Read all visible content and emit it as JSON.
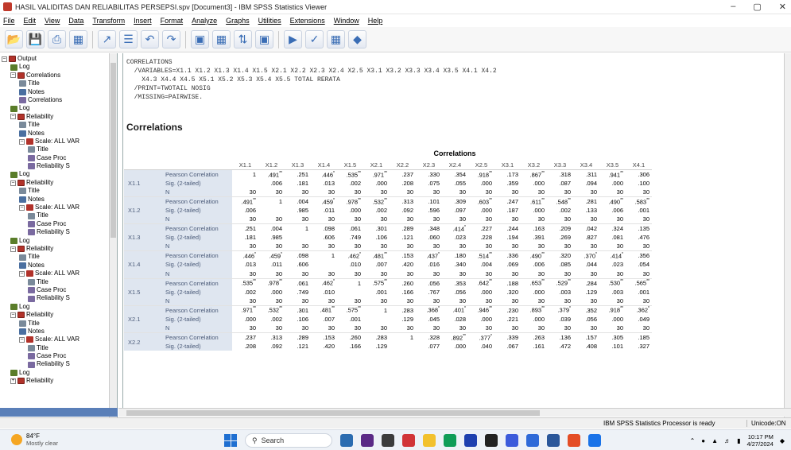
{
  "window": {
    "title": "HASIL VALIDITAS DAN RELIABILITAS PERSEPSI.spv [Document3] - IBM SPSS Statistics Viewer",
    "controls": [
      "–",
      "▢",
      "✕"
    ]
  },
  "menu": [
    "File",
    "Edit",
    "View",
    "Data",
    "Transform",
    "Insert",
    "Format",
    "Analyze",
    "Graphs",
    "Utilities",
    "Extensions",
    "Window",
    "Help"
  ],
  "toolbar": {
    "buttons": [
      "open-folder-icon",
      "save-icon",
      "print-icon",
      "print-preview-icon",
      "export-icon",
      "recall-dialog-icon",
      "undo-icon",
      "redo-icon",
      "goto-data-icon",
      "goto-case-icon",
      "variables-icon",
      "split-icon",
      "insert-output-icon",
      "select-cases-icon",
      "show-all-icon",
      "designated-window-icon"
    ]
  },
  "outline": {
    "items": [
      {
        "depth": 0,
        "label": "Output",
        "icon": "book",
        "exp": "–"
      },
      {
        "depth": 1,
        "label": "Log",
        "icon": "log"
      },
      {
        "depth": 1,
        "label": "Correlations",
        "icon": "book",
        "exp": "–"
      },
      {
        "depth": 2,
        "label": "Title",
        "icon": "title"
      },
      {
        "depth": 2,
        "label": "Notes",
        "icon": "notes"
      },
      {
        "depth": 2,
        "label": "Correlations",
        "icon": "table"
      },
      {
        "depth": 1,
        "label": "Log",
        "icon": "log"
      },
      {
        "depth": 1,
        "label": "Reliability",
        "icon": "book",
        "exp": "–"
      },
      {
        "depth": 2,
        "label": "Title",
        "icon": "title"
      },
      {
        "depth": 2,
        "label": "Notes",
        "icon": "notes"
      },
      {
        "depth": 2,
        "label": "Scale: ALL VAR",
        "icon": "scale",
        "exp": "–"
      },
      {
        "depth": 3,
        "label": "Title",
        "icon": "title"
      },
      {
        "depth": 3,
        "label": "Case Proc",
        "icon": "table"
      },
      {
        "depth": 3,
        "label": "Reliability S",
        "icon": "table"
      },
      {
        "depth": 1,
        "label": "Log",
        "icon": "log"
      },
      {
        "depth": 1,
        "label": "Reliability",
        "icon": "book",
        "exp": "–"
      },
      {
        "depth": 2,
        "label": "Title",
        "icon": "title"
      },
      {
        "depth": 2,
        "label": "Notes",
        "icon": "notes"
      },
      {
        "depth": 2,
        "label": "Scale: ALL VAR",
        "icon": "scale",
        "exp": "–"
      },
      {
        "depth": 3,
        "label": "Title",
        "icon": "title"
      },
      {
        "depth": 3,
        "label": "Case Proc",
        "icon": "table"
      },
      {
        "depth": 3,
        "label": "Reliability S",
        "icon": "table"
      },
      {
        "depth": 1,
        "label": "Log",
        "icon": "log"
      },
      {
        "depth": 1,
        "label": "Reliability",
        "icon": "book",
        "exp": "–"
      },
      {
        "depth": 2,
        "label": "Title",
        "icon": "title"
      },
      {
        "depth": 2,
        "label": "Notes",
        "icon": "notes"
      },
      {
        "depth": 2,
        "label": "Scale: ALL VAR",
        "icon": "scale",
        "exp": "–"
      },
      {
        "depth": 3,
        "label": "Title",
        "icon": "title"
      },
      {
        "depth": 3,
        "label": "Case Proc",
        "icon": "table"
      },
      {
        "depth": 3,
        "label": "Reliability S",
        "icon": "table"
      },
      {
        "depth": 1,
        "label": "Log",
        "icon": "log"
      },
      {
        "depth": 1,
        "label": "Reliability",
        "icon": "book",
        "exp": "–"
      },
      {
        "depth": 2,
        "label": "Title",
        "icon": "title"
      },
      {
        "depth": 2,
        "label": "Notes",
        "icon": "notes"
      },
      {
        "depth": 2,
        "label": "Scale: ALL VAR",
        "icon": "scale",
        "exp": "–"
      },
      {
        "depth": 3,
        "label": "Title",
        "icon": "title"
      },
      {
        "depth": 3,
        "label": "Case Proc",
        "icon": "table"
      },
      {
        "depth": 3,
        "label": "Reliability S",
        "icon": "table"
      },
      {
        "depth": 1,
        "label": "Log",
        "icon": "log"
      },
      {
        "depth": 1,
        "label": "Reliability",
        "icon": "book",
        "exp": "+"
      }
    ]
  },
  "syntax": "CORRELATIONS\n  /VARIABLES=X1.1 X1.2 X1.3 X1.4 X1.5 X2.1 X2.2 X2.3 X2.4 X2.5 X3.1 X3.2 X3.3 X3.4 X3.5 X4.1 X4.2\n    X4.3 X4.4 X4.5 X5.1 X5.2 X5.3 X5.4 X5.5 TOTAL RERATA\n  /PRINT=TWOTAIL NOSIG\n  /MISSING=PAIRWISE.",
  "heading": "Correlations",
  "table": {
    "title": "Correlations",
    "columns": [
      "X1.1",
      "X1.2",
      "X1.3",
      "X1.4",
      "X1.5",
      "X2.1",
      "X2.2",
      "X2.3",
      "X2.4",
      "X2.5",
      "X3.1",
      "X3.2",
      "X3.3",
      "X3.4",
      "X3.5",
      "X4.1"
    ],
    "stats": [
      "Pearson Correlation",
      "Sig. (2-tailed)",
      "N"
    ],
    "rows": [
      {
        "var": "X1.1",
        "values": [
          [
            "1",
            ".491**",
            ".251",
            ".446*",
            ".535**",
            ".971**",
            ".237",
            ".330",
            ".354",
            ".918**",
            ".173",
            ".867**",
            ".318",
            ".311",
            ".941**",
            ".306"
          ],
          [
            "",
            ".006",
            ".181",
            ".013",
            ".002",
            ".000",
            ".208",
            ".075",
            ".055",
            ".000",
            ".359",
            ".000",
            ".087",
            ".094",
            ".000",
            ".100"
          ],
          [
            "30",
            "30",
            "30",
            "30",
            "30",
            "30",
            "30",
            "30",
            "30",
            "30",
            "30",
            "30",
            "30",
            "30",
            "30",
            "30"
          ]
        ]
      },
      {
        "var": "X1.2",
        "values": [
          [
            ".491**",
            "1",
            ".004",
            ".459*",
            ".978**",
            ".532**",
            ".313",
            ".101",
            ".309",
            ".603**",
            ".247",
            ".611**",
            ".548**",
            ".281",
            ".490**",
            ".583**"
          ],
          [
            ".006",
            "",
            ".985",
            ".011",
            ".000",
            ".002",
            ".092",
            ".596",
            ".097",
            ".000",
            ".187",
            ".000",
            ".002",
            ".133",
            ".006",
            ".001"
          ],
          [
            "30",
            "30",
            "30",
            "30",
            "30",
            "30",
            "30",
            "30",
            "30",
            "30",
            "30",
            "30",
            "30",
            "30",
            "30",
            "30"
          ]
        ]
      },
      {
        "var": "X1.3",
        "values": [
          [
            ".251",
            ".004",
            "1",
            ".098",
            ".061",
            ".301",
            ".289",
            ".348",
            ".414*",
            ".227",
            ".244",
            ".163",
            ".209",
            ".042",
            ".324",
            ".135"
          ],
          [
            ".181",
            ".985",
            "",
            ".606",
            ".749",
            ".106",
            ".121",
            ".060",
            ".023",
            ".228",
            ".194",
            ".391",
            ".269",
            ".827",
            ".081",
            ".476"
          ],
          [
            "30",
            "30",
            "30",
            "30",
            "30",
            "30",
            "30",
            "30",
            "30",
            "30",
            "30",
            "30",
            "30",
            "30",
            "30",
            "30"
          ]
        ]
      },
      {
        "var": "X1.4",
        "values": [
          [
            ".446*",
            ".459*",
            ".098",
            "1",
            ".462*",
            ".481**",
            ".153",
            ".437*",
            ".180",
            ".514**",
            ".336",
            ".490**",
            ".320",
            ".370*",
            ".414*",
            ".356"
          ],
          [
            ".013",
            ".011",
            ".606",
            "",
            ".010",
            ".007",
            ".420",
            ".016",
            ".340",
            ".004",
            ".069",
            ".006",
            ".085",
            ".044",
            ".023",
            ".054"
          ],
          [
            "30",
            "30",
            "30",
            "30",
            "30",
            "30",
            "30",
            "30",
            "30",
            "30",
            "30",
            "30",
            "30",
            "30",
            "30",
            "30"
          ]
        ]
      },
      {
        "var": "X1.5",
        "values": [
          [
            ".535**",
            ".978**",
            ".061",
            ".462*",
            "1",
            ".575**",
            ".260",
            ".056",
            ".353",
            ".642**",
            ".188",
            ".653**",
            ".529**",
            ".284",
            ".530**",
            ".565**"
          ],
          [
            ".002",
            ".000",
            ".749",
            ".010",
            "",
            ".001",
            ".166",
            ".767",
            ".056",
            ".000",
            ".320",
            ".000",
            ".003",
            ".129",
            ".003",
            ".001"
          ],
          [
            "30",
            "30",
            "30",
            "30",
            "30",
            "30",
            "30",
            "30",
            "30",
            "30",
            "30",
            "30",
            "30",
            "30",
            "30",
            "30"
          ]
        ]
      },
      {
        "var": "X2.1",
        "values": [
          [
            ".971**",
            ".532**",
            ".301",
            ".481**",
            ".575**",
            "1",
            ".283",
            ".368*",
            ".401*",
            ".946**",
            ".230",
            ".893**",
            ".379*",
            ".352",
            ".918**",
            ".362*"
          ],
          [
            ".000",
            ".002",
            ".106",
            ".007",
            ".001",
            "",
            ".129",
            ".045",
            ".028",
            ".000",
            ".221",
            ".000",
            ".039",
            ".056",
            ".000",
            ".049"
          ],
          [
            "30",
            "30",
            "30",
            "30",
            "30",
            "30",
            "30",
            "30",
            "30",
            "30",
            "30",
            "30",
            "30",
            "30",
            "30",
            "30"
          ]
        ]
      },
      {
        "var": "X2.2",
        "values": [
          [
            ".237",
            ".313",
            ".289",
            ".153",
            ".260",
            ".283",
            "1",
            ".328",
            ".892**",
            ".377*",
            ".339",
            ".263",
            ".136",
            ".157",
            ".305",
            ".185"
          ],
          [
            ".208",
            ".092",
            ".121",
            ".420",
            ".166",
            ".129",
            "",
            ".077",
            ".000",
            ".040",
            ".067",
            ".161",
            ".472",
            ".408",
            ".101",
            ".327"
          ]
        ]
      }
    ]
  },
  "status": {
    "processor": "IBM SPSS Statistics Processor is ready",
    "unicode": "Unicode:ON"
  },
  "taskbar": {
    "temp": "84°F",
    "weather": "Mostly clear",
    "search": "Search",
    "time": "10:17 PM",
    "date": "4/27/2024"
  },
  "colors": {
    "header_bg": "#dfe6f0",
    "header_text": "#4a5a78",
    "accent": "#1f6fd1"
  }
}
